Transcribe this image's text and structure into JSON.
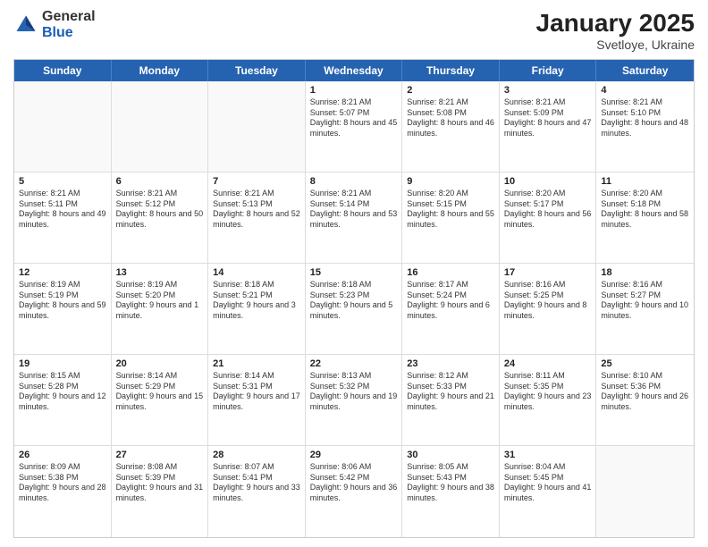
{
  "logo": {
    "general": "General",
    "blue": "Blue"
  },
  "title": "January 2025",
  "subtitle": "Svetloye, Ukraine",
  "header_days": [
    "Sunday",
    "Monday",
    "Tuesday",
    "Wednesday",
    "Thursday",
    "Friday",
    "Saturday"
  ],
  "weeks": [
    [
      {
        "day": "",
        "sunrise": "",
        "sunset": "",
        "daylight": "",
        "empty": true
      },
      {
        "day": "",
        "sunrise": "",
        "sunset": "",
        "daylight": "",
        "empty": true
      },
      {
        "day": "",
        "sunrise": "",
        "sunset": "",
        "daylight": "",
        "empty": true
      },
      {
        "day": "1",
        "sunrise": "Sunrise: 8:21 AM",
        "sunset": "Sunset: 5:07 PM",
        "daylight": "Daylight: 8 hours and 45 minutes.",
        "empty": false
      },
      {
        "day": "2",
        "sunrise": "Sunrise: 8:21 AM",
        "sunset": "Sunset: 5:08 PM",
        "daylight": "Daylight: 8 hours and 46 minutes.",
        "empty": false
      },
      {
        "day": "3",
        "sunrise": "Sunrise: 8:21 AM",
        "sunset": "Sunset: 5:09 PM",
        "daylight": "Daylight: 8 hours and 47 minutes.",
        "empty": false
      },
      {
        "day": "4",
        "sunrise": "Sunrise: 8:21 AM",
        "sunset": "Sunset: 5:10 PM",
        "daylight": "Daylight: 8 hours and 48 minutes.",
        "empty": false
      }
    ],
    [
      {
        "day": "5",
        "sunrise": "Sunrise: 8:21 AM",
        "sunset": "Sunset: 5:11 PM",
        "daylight": "Daylight: 8 hours and 49 minutes.",
        "empty": false
      },
      {
        "day": "6",
        "sunrise": "Sunrise: 8:21 AM",
        "sunset": "Sunset: 5:12 PM",
        "daylight": "Daylight: 8 hours and 50 minutes.",
        "empty": false
      },
      {
        "day": "7",
        "sunrise": "Sunrise: 8:21 AM",
        "sunset": "Sunset: 5:13 PM",
        "daylight": "Daylight: 8 hours and 52 minutes.",
        "empty": false
      },
      {
        "day": "8",
        "sunrise": "Sunrise: 8:21 AM",
        "sunset": "Sunset: 5:14 PM",
        "daylight": "Daylight: 8 hours and 53 minutes.",
        "empty": false
      },
      {
        "day": "9",
        "sunrise": "Sunrise: 8:20 AM",
        "sunset": "Sunset: 5:15 PM",
        "daylight": "Daylight: 8 hours and 55 minutes.",
        "empty": false
      },
      {
        "day": "10",
        "sunrise": "Sunrise: 8:20 AM",
        "sunset": "Sunset: 5:17 PM",
        "daylight": "Daylight: 8 hours and 56 minutes.",
        "empty": false
      },
      {
        "day": "11",
        "sunrise": "Sunrise: 8:20 AM",
        "sunset": "Sunset: 5:18 PM",
        "daylight": "Daylight: 8 hours and 58 minutes.",
        "empty": false
      }
    ],
    [
      {
        "day": "12",
        "sunrise": "Sunrise: 8:19 AM",
        "sunset": "Sunset: 5:19 PM",
        "daylight": "Daylight: 8 hours and 59 minutes.",
        "empty": false
      },
      {
        "day": "13",
        "sunrise": "Sunrise: 8:19 AM",
        "sunset": "Sunset: 5:20 PM",
        "daylight": "Daylight: 9 hours and 1 minute.",
        "empty": false
      },
      {
        "day": "14",
        "sunrise": "Sunrise: 8:18 AM",
        "sunset": "Sunset: 5:21 PM",
        "daylight": "Daylight: 9 hours and 3 minutes.",
        "empty": false
      },
      {
        "day": "15",
        "sunrise": "Sunrise: 8:18 AM",
        "sunset": "Sunset: 5:23 PM",
        "daylight": "Daylight: 9 hours and 5 minutes.",
        "empty": false
      },
      {
        "day": "16",
        "sunrise": "Sunrise: 8:17 AM",
        "sunset": "Sunset: 5:24 PM",
        "daylight": "Daylight: 9 hours and 6 minutes.",
        "empty": false
      },
      {
        "day": "17",
        "sunrise": "Sunrise: 8:16 AM",
        "sunset": "Sunset: 5:25 PM",
        "daylight": "Daylight: 9 hours and 8 minutes.",
        "empty": false
      },
      {
        "day": "18",
        "sunrise": "Sunrise: 8:16 AM",
        "sunset": "Sunset: 5:27 PM",
        "daylight": "Daylight: 9 hours and 10 minutes.",
        "empty": false
      }
    ],
    [
      {
        "day": "19",
        "sunrise": "Sunrise: 8:15 AM",
        "sunset": "Sunset: 5:28 PM",
        "daylight": "Daylight: 9 hours and 12 minutes.",
        "empty": false
      },
      {
        "day": "20",
        "sunrise": "Sunrise: 8:14 AM",
        "sunset": "Sunset: 5:29 PM",
        "daylight": "Daylight: 9 hours and 15 minutes.",
        "empty": false
      },
      {
        "day": "21",
        "sunrise": "Sunrise: 8:14 AM",
        "sunset": "Sunset: 5:31 PM",
        "daylight": "Daylight: 9 hours and 17 minutes.",
        "empty": false
      },
      {
        "day": "22",
        "sunrise": "Sunrise: 8:13 AM",
        "sunset": "Sunset: 5:32 PM",
        "daylight": "Daylight: 9 hours and 19 minutes.",
        "empty": false
      },
      {
        "day": "23",
        "sunrise": "Sunrise: 8:12 AM",
        "sunset": "Sunset: 5:33 PM",
        "daylight": "Daylight: 9 hours and 21 minutes.",
        "empty": false
      },
      {
        "day": "24",
        "sunrise": "Sunrise: 8:11 AM",
        "sunset": "Sunset: 5:35 PM",
        "daylight": "Daylight: 9 hours and 23 minutes.",
        "empty": false
      },
      {
        "day": "25",
        "sunrise": "Sunrise: 8:10 AM",
        "sunset": "Sunset: 5:36 PM",
        "daylight": "Daylight: 9 hours and 26 minutes.",
        "empty": false
      }
    ],
    [
      {
        "day": "26",
        "sunrise": "Sunrise: 8:09 AM",
        "sunset": "Sunset: 5:38 PM",
        "daylight": "Daylight: 9 hours and 28 minutes.",
        "empty": false
      },
      {
        "day": "27",
        "sunrise": "Sunrise: 8:08 AM",
        "sunset": "Sunset: 5:39 PM",
        "daylight": "Daylight: 9 hours and 31 minutes.",
        "empty": false
      },
      {
        "day": "28",
        "sunrise": "Sunrise: 8:07 AM",
        "sunset": "Sunset: 5:41 PM",
        "daylight": "Daylight: 9 hours and 33 minutes.",
        "empty": false
      },
      {
        "day": "29",
        "sunrise": "Sunrise: 8:06 AM",
        "sunset": "Sunset: 5:42 PM",
        "daylight": "Daylight: 9 hours and 36 minutes.",
        "empty": false
      },
      {
        "day": "30",
        "sunrise": "Sunrise: 8:05 AM",
        "sunset": "Sunset: 5:43 PM",
        "daylight": "Daylight: 9 hours and 38 minutes.",
        "empty": false
      },
      {
        "day": "31",
        "sunrise": "Sunrise: 8:04 AM",
        "sunset": "Sunset: 5:45 PM",
        "daylight": "Daylight: 9 hours and 41 minutes.",
        "empty": false
      },
      {
        "day": "",
        "sunrise": "",
        "sunset": "",
        "daylight": "",
        "empty": true
      }
    ]
  ]
}
